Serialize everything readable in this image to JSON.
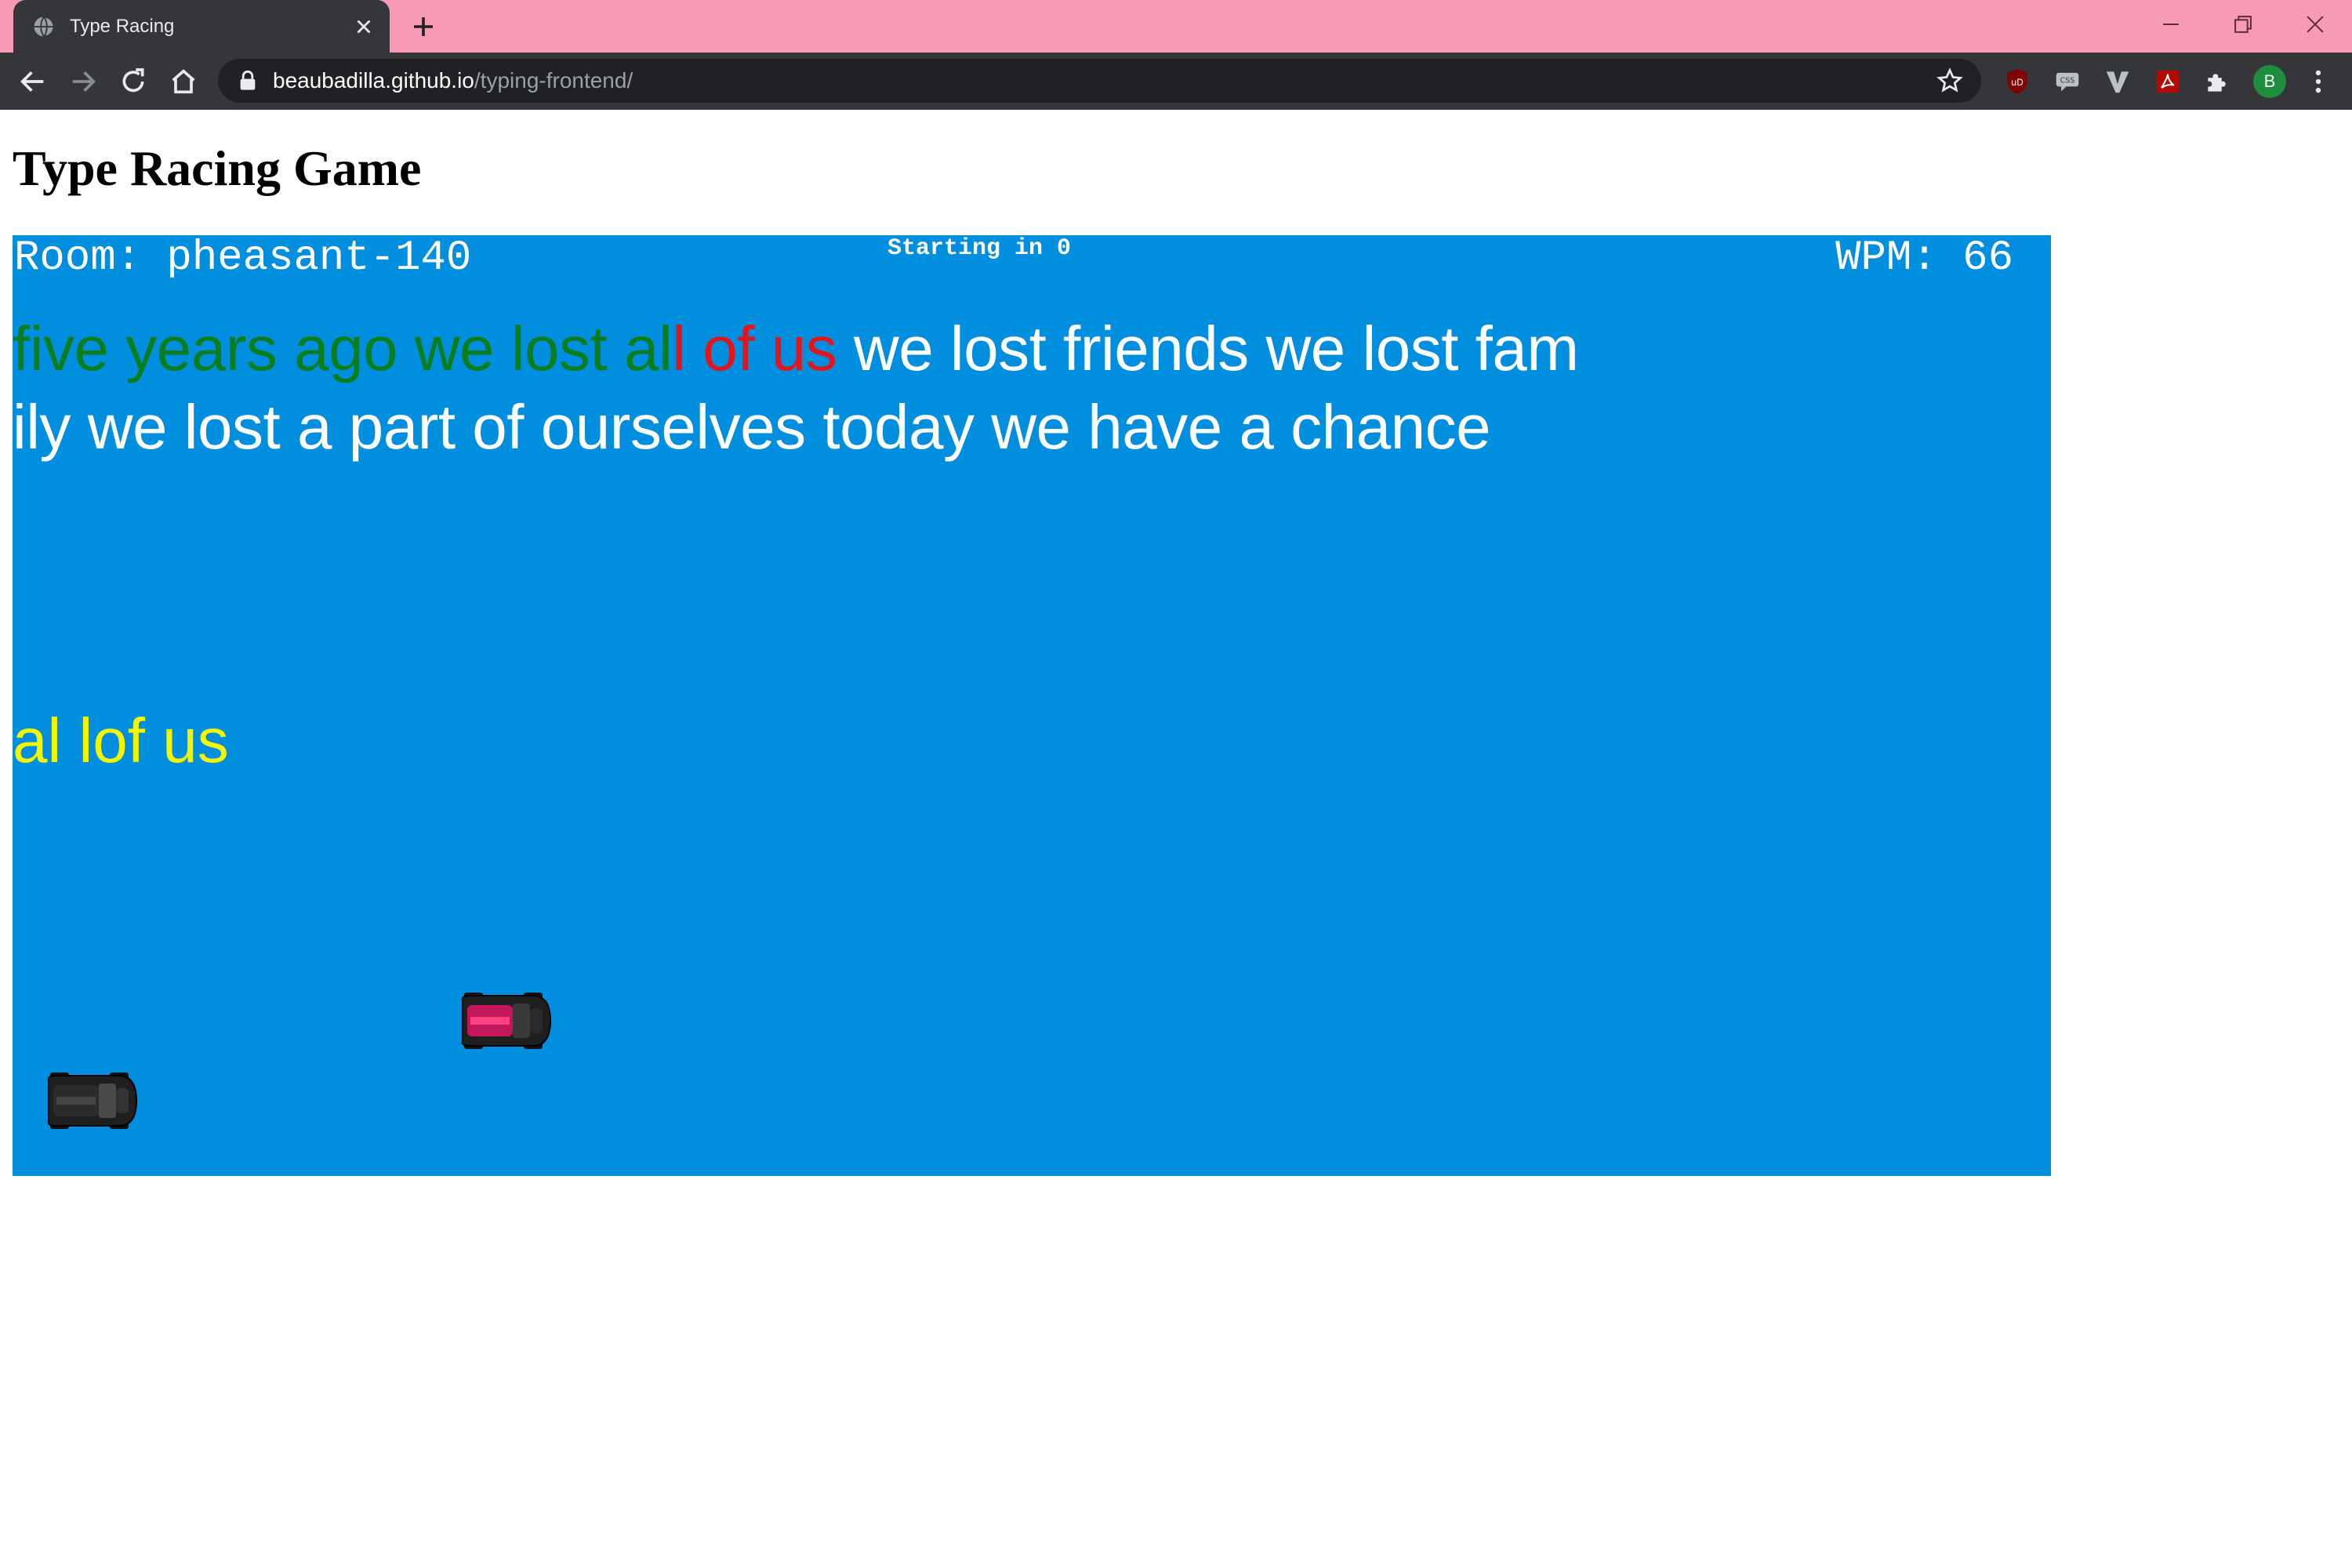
{
  "browser": {
    "tab_title": "Type Racing",
    "url_host": "beaubadilla.github.io",
    "url_path": "/typing-frontend/",
    "profile_initial": "B",
    "accent_color": "#f79ab4"
  },
  "page": {
    "title": "Type Racing Game"
  },
  "game": {
    "room_label": "Room: pheasant-140",
    "countdown": "Starting in 0",
    "wpm_label": "WPM: 66",
    "background_color": "#008fde",
    "passage": {
      "line1_correct": "five years ago we lost al",
      "line1_error": "l of us",
      "line1_remaining": " we lost friends we lost fam",
      "line2": "ily we lost a part of ourselves today we have a chance"
    },
    "typed_input": "al lof us",
    "cars": [
      {
        "name": "opponent-car",
        "color": "#c2185b"
      },
      {
        "name": "player-car",
        "color": "#2b2b2b"
      }
    ]
  }
}
